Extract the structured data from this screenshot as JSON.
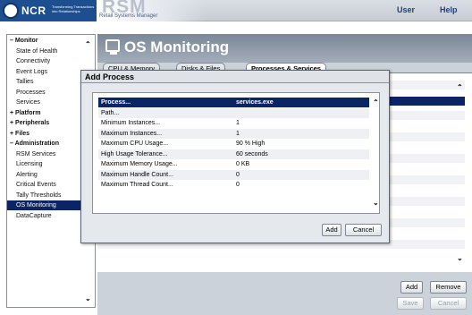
{
  "header": {
    "brand": "NCR",
    "tagline": "Transforming Transactions into Relationships",
    "product": "RSM",
    "product_full": "Retail Systems Manager",
    "nav": {
      "user": "User",
      "help": "Help"
    }
  },
  "sidebar": {
    "items": [
      {
        "label": "Monitor",
        "type": "group",
        "prefix": "–"
      },
      {
        "label": "State of Health",
        "type": "child"
      },
      {
        "label": "Connectivity",
        "type": "child"
      },
      {
        "label": "Event Logs",
        "type": "child"
      },
      {
        "label": "Tallies",
        "type": "child"
      },
      {
        "label": "Processes",
        "type": "child"
      },
      {
        "label": "Services",
        "type": "child"
      },
      {
        "label": "Platform",
        "type": "group",
        "prefix": "+"
      },
      {
        "label": "Peripherals",
        "type": "group",
        "prefix": "+"
      },
      {
        "label": "Files",
        "type": "group",
        "prefix": "+"
      },
      {
        "label": "Administration",
        "type": "group",
        "prefix": "–"
      },
      {
        "label": "RSM Services",
        "type": "child"
      },
      {
        "label": "Licensing",
        "type": "child"
      },
      {
        "label": "Alerting",
        "type": "child"
      },
      {
        "label": "Critical Events",
        "type": "child"
      },
      {
        "label": "Tally Thresholds",
        "type": "child"
      },
      {
        "label": "OS Monitoring",
        "type": "selected"
      },
      {
        "label": "DataCapture",
        "type": "child"
      }
    ]
  },
  "main": {
    "title": "OS Monitoring",
    "tabs": [
      {
        "label": "CPU & Memory"
      },
      {
        "label": "Disks & Files"
      },
      {
        "label": "Processes & Services",
        "active": true
      }
    ],
    "buttons": {
      "add": "Add",
      "remove": "Remove",
      "save": "Save",
      "cancel": "Cancel"
    }
  },
  "dialog": {
    "title": "Add Process",
    "rows": [
      {
        "name": "Process...",
        "value": "services.exe",
        "selected": true
      },
      {
        "name": "Path...",
        "value": ""
      },
      {
        "name": "Minimum Instances...",
        "value": "1"
      },
      {
        "name": "Maximum Instances...",
        "value": "1"
      },
      {
        "name": "Maximum CPU Usage...",
        "value": "90 % High"
      },
      {
        "name": "High Usage Tolerance...",
        "value": "60 seconds"
      },
      {
        "name": "Maximum Memory Usage...",
        "value": "0 KB"
      },
      {
        "name": "Maximum Handle Count...",
        "value": "0"
      },
      {
        "name": "Maximum Thread Count...",
        "value": "0"
      }
    ],
    "buttons": {
      "add": "Add",
      "cancel": "Cancel"
    }
  },
  "colors": {
    "selection": "#0b2466",
    "title_band": "#7b8797",
    "link": "#1d3f7c"
  }
}
